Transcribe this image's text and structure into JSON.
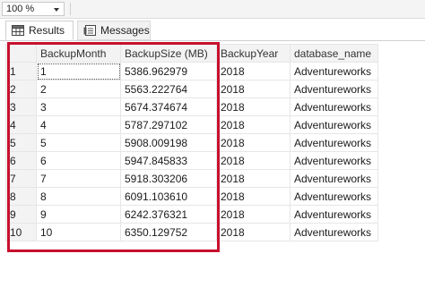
{
  "toolbar": {
    "zoom_value": "100 %"
  },
  "tabs": [
    {
      "label": "Results",
      "icon": "grid-icon",
      "active": true
    },
    {
      "label": "Messages",
      "icon": "messages-icon",
      "active": false
    }
  ],
  "grid": {
    "columns": [
      "",
      "BackupMonth",
      "BackupSize (MB)",
      "BackupYear",
      "database_name"
    ],
    "rows": [
      [
        "1",
        "1",
        "5386.962979",
        "2018",
        "Adventureworks"
      ],
      [
        "2",
        "2",
        "5563.222764",
        "2018",
        "Adventureworks"
      ],
      [
        "3",
        "3",
        "5674.374674",
        "2018",
        "Adventureworks"
      ],
      [
        "4",
        "4",
        "5787.297102",
        "2018",
        "Adventureworks"
      ],
      [
        "5",
        "5",
        "5908.009198",
        "2018",
        "Adventureworks"
      ],
      [
        "6",
        "6",
        "5947.845833",
        "2018",
        "Adventureworks"
      ],
      [
        "7",
        "7",
        "5918.303206",
        "2018",
        "Adventureworks"
      ],
      [
        "8",
        "8",
        "6091.103610",
        "2018",
        "Adventureworks"
      ],
      [
        "9",
        "9",
        "6242.376321",
        "2018",
        "Adventureworks"
      ],
      [
        "10",
        "10",
        "6350.129752",
        "2018",
        "Adventureworks"
      ]
    ]
  },
  "colors": {
    "highlight": "#c8102e"
  }
}
